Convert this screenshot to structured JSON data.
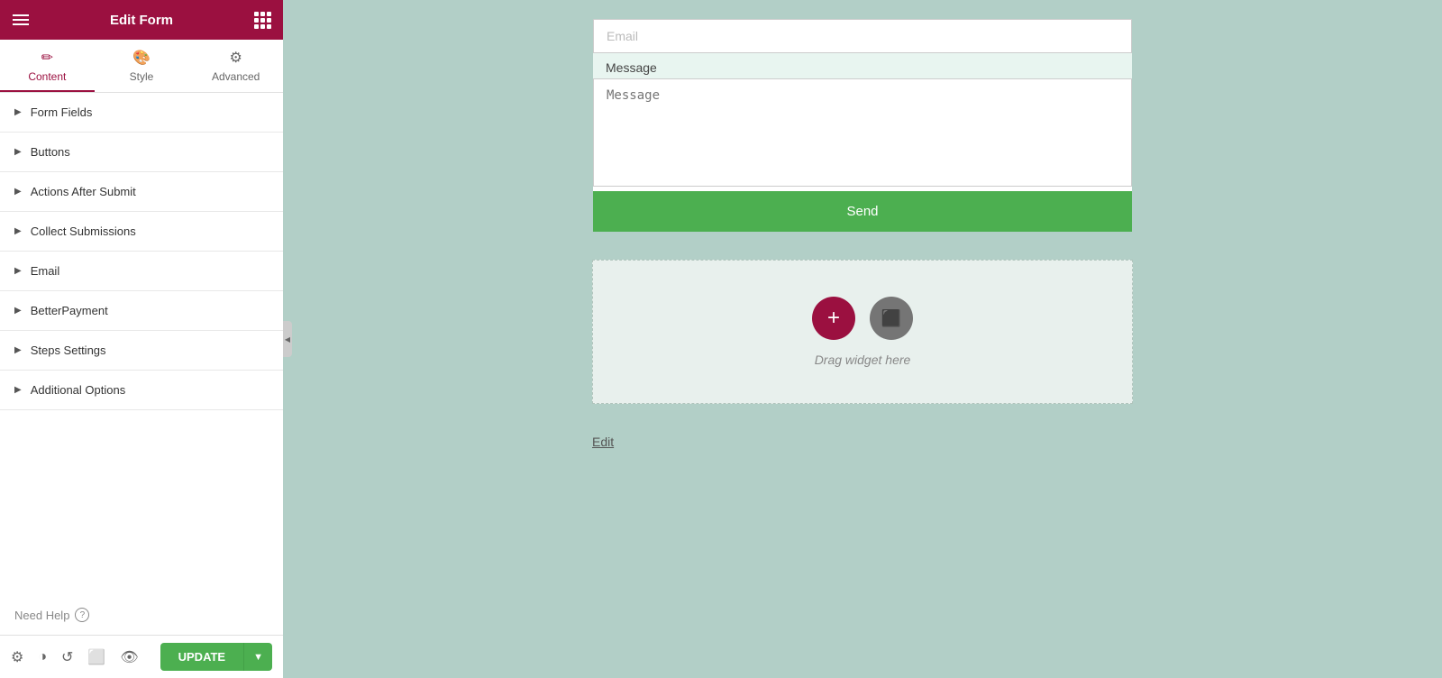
{
  "header": {
    "title": "Edit Form",
    "hamburger_label": "menu",
    "grid_label": "apps"
  },
  "tabs": [
    {
      "id": "content",
      "label": "Content",
      "icon": "✏️",
      "active": true
    },
    {
      "id": "style",
      "label": "Style",
      "icon": "🎨",
      "active": false
    },
    {
      "id": "advanced",
      "label": "Advanced",
      "icon": "⚙️",
      "active": false
    }
  ],
  "accordion": {
    "items": [
      {
        "id": "form-fields",
        "label": "Form Fields"
      },
      {
        "id": "buttons",
        "label": "Buttons"
      },
      {
        "id": "actions-after-submit",
        "label": "Actions After Submit"
      },
      {
        "id": "collect-submissions",
        "label": "Collect Submissions"
      },
      {
        "id": "email",
        "label": "Email"
      },
      {
        "id": "better-payment",
        "label": "BetterPayment"
      },
      {
        "id": "steps-settings",
        "label": "Steps Settings"
      },
      {
        "id": "additional-options",
        "label": "Additional Options"
      }
    ]
  },
  "need_help": {
    "label": "Need Help",
    "icon": "?"
  },
  "footer": {
    "icons": [
      "⚙️",
      "◑",
      "↺",
      "⬜",
      "👁"
    ],
    "update_label": "UPDATE",
    "arrow_label": "▼"
  },
  "form": {
    "email_placeholder": "Email",
    "message_label": "Message",
    "message_placeholder": "Message",
    "send_label": "Send"
  },
  "drag_widget": {
    "label": "Drag widget here",
    "add_icon": "+",
    "widget_icon": "⬛"
  },
  "edit_link": {
    "label": "Edit"
  },
  "colors": {
    "header_bg": "#9b1040",
    "active_tab": "#9b1040",
    "send_btn": "#4caf50",
    "update_btn": "#4caf50",
    "add_circle": "#9b1040",
    "widget_circle": "#757575",
    "canvas_bg": "#b2cfc7"
  }
}
